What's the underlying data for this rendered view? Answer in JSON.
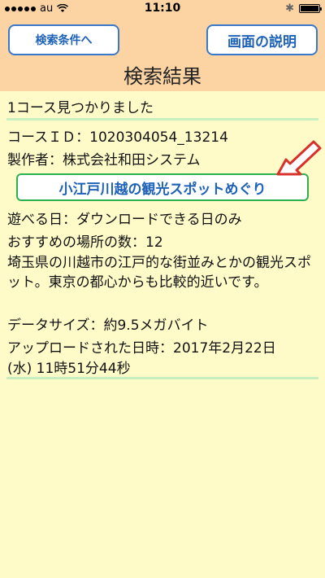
{
  "status": {
    "carrier": "au",
    "time": "11:10",
    "battery_level": 0.9
  },
  "header": {
    "left_button_label": "検索条件へ",
    "right_button_label": "画面の説明",
    "title": "検索結果"
  },
  "result": {
    "count_text": "1コース見つかりました",
    "course_id": "コースＩＤ：1020304054_13214",
    "author": "製作者：株式会社和田システム",
    "course_name": "小江戸川越の観光スポットめぐり",
    "playable_day": "遊べる日：ダウンロードできる日のみ",
    "recommended_count": "おすすめの場所の数：12",
    "description": "埼玉県の川越市の江戸的な街並みとかの観光スポット。東京の都心からも比較的近いです。",
    "data_size": "データサイズ：約9.5メガバイト",
    "uploaded_line1": "アップロードされた日時：2017年2月22日",
    "uploaded_line2": "(水) 11時51分44秒"
  },
  "colors": {
    "header_bg": "#fcd4a4",
    "content_bg": "#fffbc8",
    "button_border": "#3a78c9",
    "course_button_border": "#2fb050",
    "arrow_fill": "#ffffff",
    "arrow_stroke": "#d9302a"
  },
  "icons": [
    "signal-icon",
    "wifi-icon",
    "bluetooth-icon",
    "battery-icon",
    "pointer-arrow-icon"
  ]
}
